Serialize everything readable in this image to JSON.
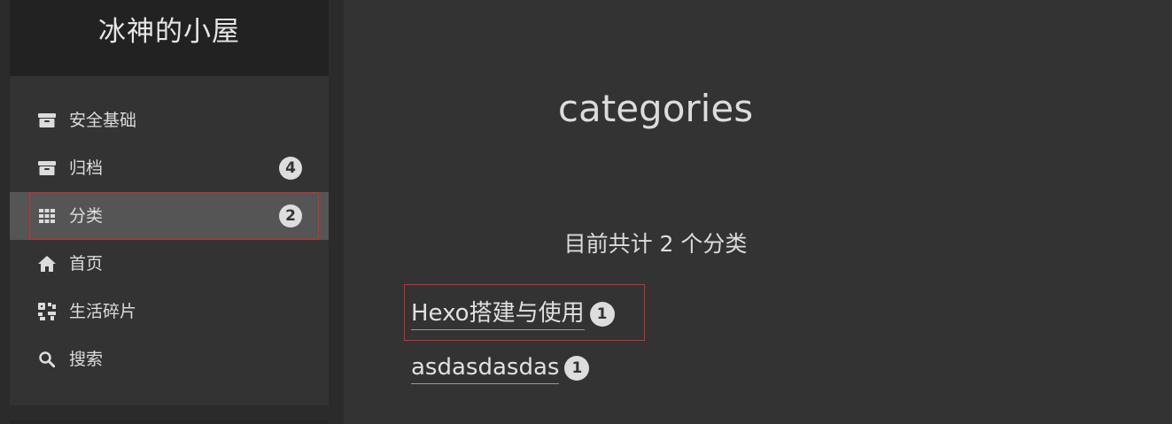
{
  "site": {
    "title": "冰神的小屋"
  },
  "menu": {
    "items": [
      {
        "label": "安全基础",
        "icon": "archive-icon"
      },
      {
        "label": "归档",
        "icon": "archive-icon",
        "badge": "4"
      },
      {
        "label": "分类",
        "icon": "th-grid-icon",
        "badge": "2",
        "active": true
      },
      {
        "label": "首页",
        "icon": "home-icon"
      },
      {
        "label": "生活碎片",
        "icon": "fragments-icon"
      },
      {
        "label": "搜索",
        "icon": "search-icon"
      }
    ]
  },
  "page": {
    "title": "categories",
    "summary": "目前共计 2 个分类"
  },
  "categories": [
    {
      "name": "Hexo搭建与使用",
      "count": "1"
    },
    {
      "name": "asdasdasdas",
      "count": "1"
    }
  ],
  "colors": {
    "highlight": "#d8282b",
    "active_bg": "#555555",
    "badge_bg": "#dddddd"
  }
}
